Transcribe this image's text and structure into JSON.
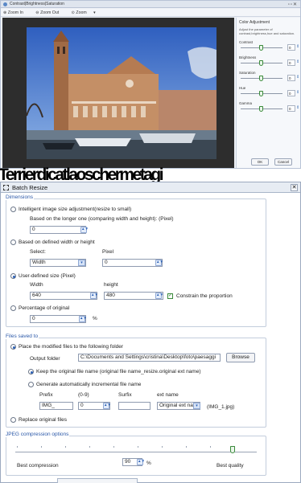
{
  "window1": {
    "title": "Contrast|Brightness|Saturation",
    "toolbar": [
      "Zoom In",
      "Zoom Out",
      "Zoom"
    ],
    "panel_title": "Color Adjustment",
    "panel_desc": "Adjust the parameter of contrast,brightness,hue and saturation.",
    "sliders": [
      {
        "label": "Contrast",
        "value": "0"
      },
      {
        "label": "Brightness",
        "value": "0"
      },
      {
        "label": "Saturation",
        "value": "0"
      },
      {
        "label": "Hue",
        "value": "0"
      },
      {
        "label": "Gamma",
        "value": "0"
      }
    ],
    "ok": "OK",
    "cancel": "Cancel"
  },
  "overlap_text": "Terrierdicatlaoschermetagi",
  "dialog": {
    "title": "Batch Resize",
    "dimensions": {
      "legend": "Dimensions",
      "opt_intelligent": "Intelligent image size adjustment(resize to small)",
      "longer_one": "Based on the longer one (comparing width and height): (Pixel)",
      "longer_value": "0",
      "opt_defined": "Based on defined width or height",
      "select_label": "Select:",
      "pixel_label": "Pixel",
      "select_value": "Width",
      "pixel_value": "0",
      "opt_user": "User-defined size (Pixel)",
      "width_label": "Width",
      "height_label": "height",
      "width_value": "640",
      "height_value": "480",
      "constrain": "Constrain the proportion",
      "opt_percentage": "Percentage of original",
      "percent_value": "0",
      "percent_unit": "%"
    },
    "files": {
      "legend": "Files saved to",
      "opt_place": "Place the modified files to the following folder",
      "output_label": "Output folder",
      "output_value": "C:\\Documents and Settings\\cristina\\Desktop\\foto\\paesaggi",
      "browse": "Browse",
      "keep_name": "Keep the original file name (original file name_resize.original ext name)",
      "gen_name": "Generate automatically incremental file name",
      "prefix_label": "Prefix",
      "range_label": "(0-9)",
      "suffix_label": "Surfix",
      "ext_label": "ext name",
      "prefix_value": "IMG_",
      "range_value": "0",
      "suffix_value": "",
      "ext_value": "Original ext na",
      "example": "(IMG_1.jpg)",
      "opt_replace": "Replace original files"
    },
    "jpeg": {
      "legend": "JPEG compression options",
      "best_compression": "Best compression",
      "quality_value": "90",
      "quality_unit": "%",
      "best_quality": "Best quality",
      "level": 0.9
    }
  }
}
